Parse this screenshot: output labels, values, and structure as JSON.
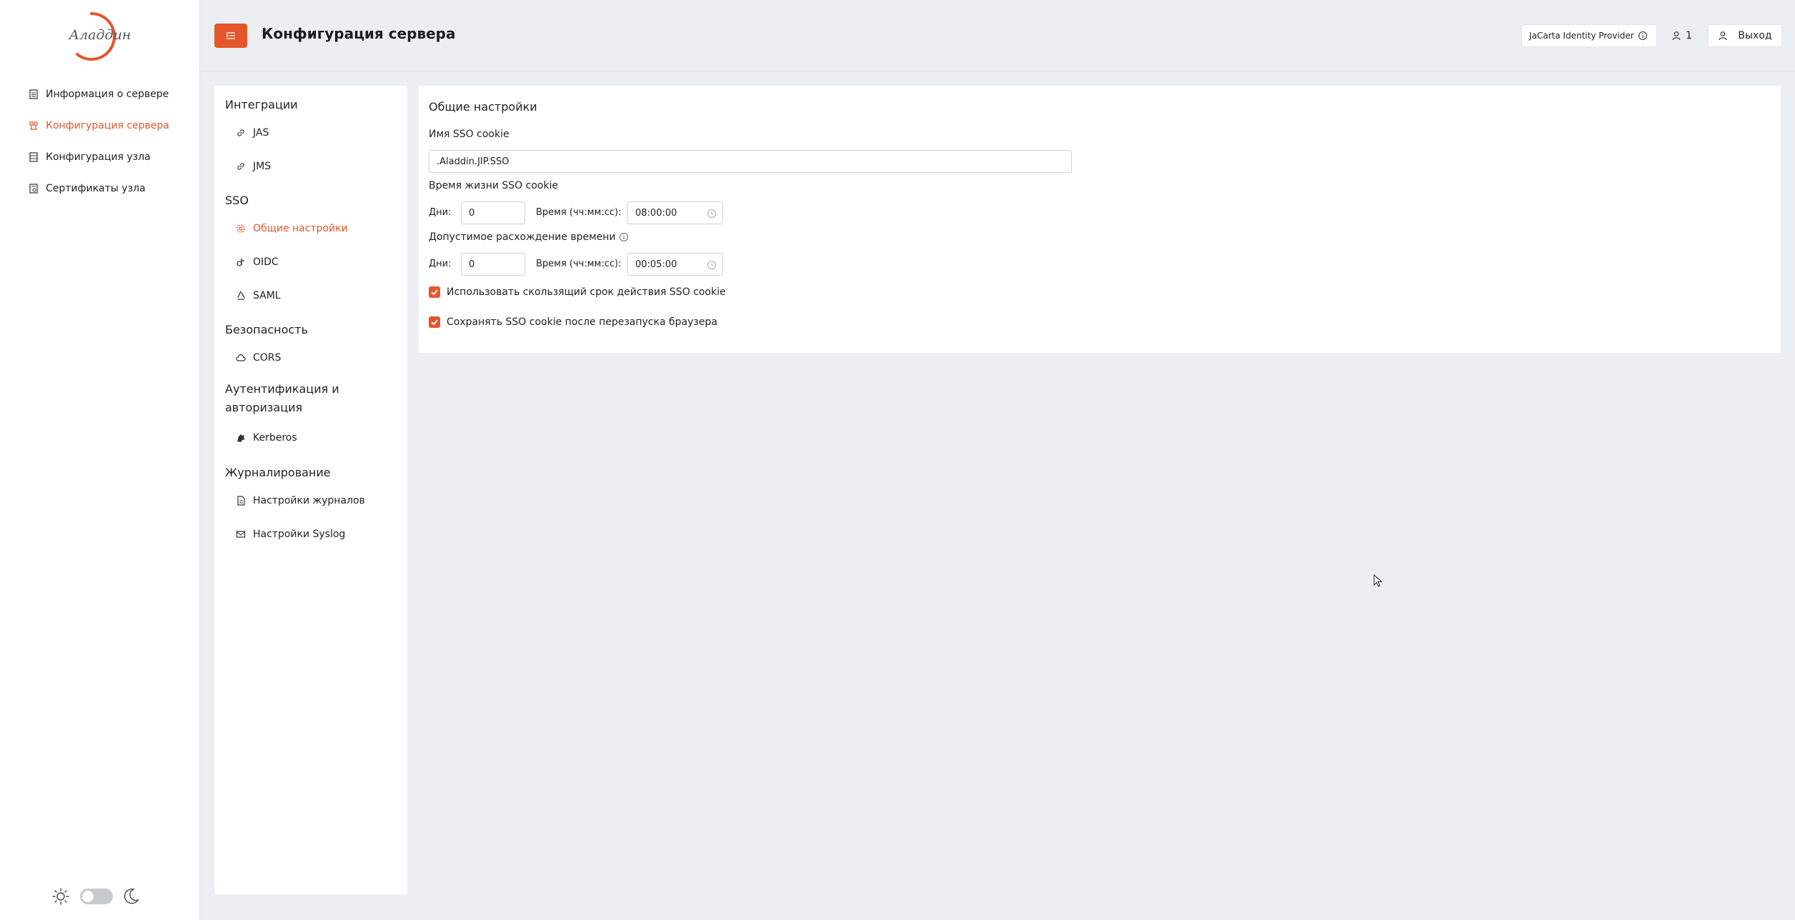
{
  "brand": {
    "logo_text": "Аладдин",
    "accent_color": "#e5562a"
  },
  "sidebar": {
    "items": [
      {
        "label": "Информация о сервере",
        "icon": "document-list-icon",
        "active": false
      },
      {
        "label": "Конфигурация сервера",
        "icon": "server-config-icon",
        "active": true
      },
      {
        "label": "Конфигурация узла",
        "icon": "node-config-icon",
        "active": false
      },
      {
        "label": "Сертификаты узла",
        "icon": "certificate-icon",
        "active": false
      }
    ],
    "theme_toggle": {
      "light_icon": "sun-icon",
      "dark_icon": "moon-icon",
      "dark_mode": false
    }
  },
  "header": {
    "title": "Конфигурация сервера",
    "provider": "JaCarta Identity Provider",
    "user_count": "1",
    "logout_label": "Выход"
  },
  "settings_nav": {
    "groups": [
      {
        "title": "Интеграции",
        "items": [
          {
            "label": "JAS",
            "icon": "link-icon"
          },
          {
            "label": "JMS",
            "icon": "link-icon"
          }
        ]
      },
      {
        "title": "SSO",
        "items": [
          {
            "label": "Общие настройки",
            "icon": "gear-icon",
            "active": true
          },
          {
            "label": "OIDC",
            "icon": "oidc-icon"
          },
          {
            "label": "SAML",
            "icon": "saml-icon"
          }
        ]
      },
      {
        "title": "Безопасность",
        "items": [
          {
            "label": "CORS",
            "icon": "cloud-icon"
          }
        ]
      },
      {
        "title": "Аутентификация и авторизация",
        "items": [
          {
            "label": "Kerberos",
            "icon": "kerberos-icon"
          }
        ]
      },
      {
        "title": "Журналирование",
        "items": [
          {
            "label": "Настройки журналов",
            "icon": "log-file-icon"
          },
          {
            "label": "Настройки Syslog",
            "icon": "mail-icon"
          }
        ]
      }
    ]
  },
  "form": {
    "title": "Общие настройки",
    "sso_cookie_name": {
      "label": "Имя SSO cookie",
      "value": ".Aladdin.JIP.SSO"
    },
    "sso_cookie_lifetime": {
      "label": "Время жизни SSO cookie",
      "days_label": "Дни:",
      "days_value": "0",
      "time_label": "Время (чч:мм:сс):",
      "time_value": "08:00:00"
    },
    "clock_skew": {
      "label": "Допустимое расхождение времени",
      "days_label": "Дни:",
      "days_value": "0",
      "time_label": "Время (чч:мм:сс):",
      "time_value": "00:05:00"
    },
    "checkboxes": [
      {
        "label": "Использовать скользящий срок действия SSO cookie",
        "checked": true
      },
      {
        "label": "Сохранять SSO cookie после перезапуска браузера",
        "checked": true
      }
    ]
  }
}
